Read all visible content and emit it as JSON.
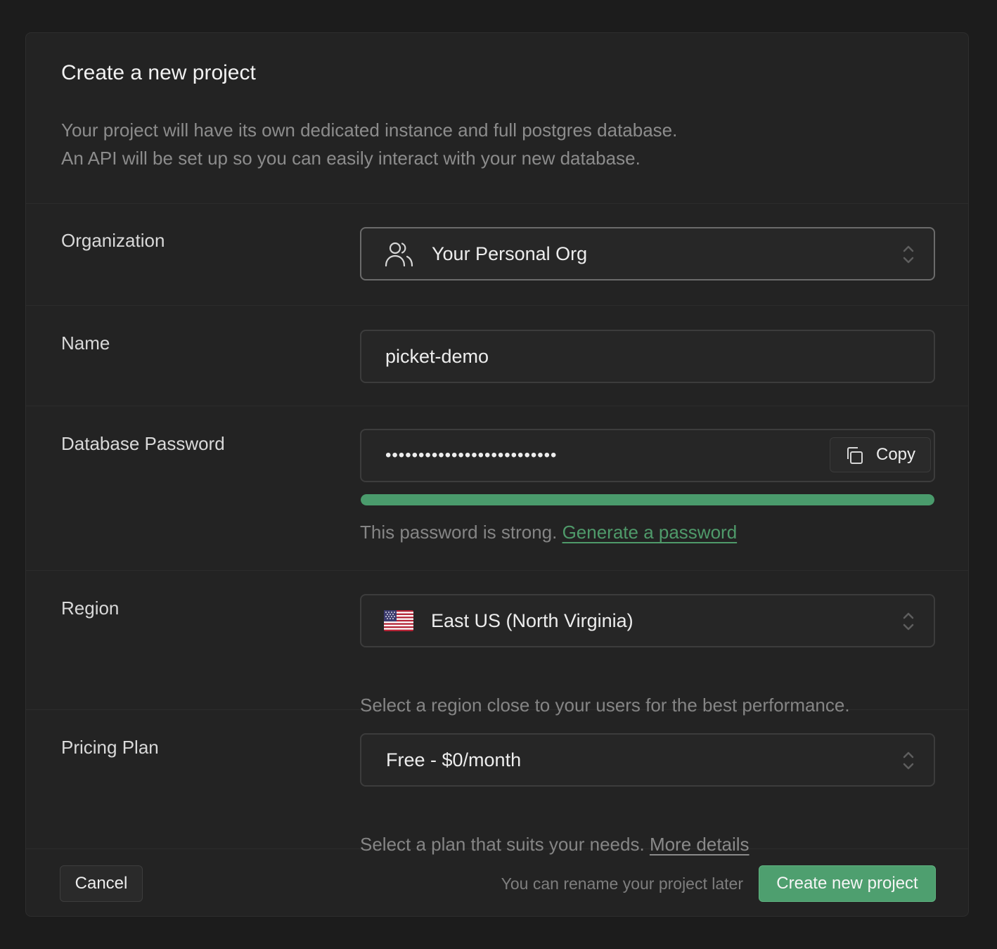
{
  "dialog": {
    "title": "Create a new project",
    "description_line1": "Your project will have its own dedicated instance and full postgres database.",
    "description_line2": "An API will be set up so you can easily interact with your new database."
  },
  "organization": {
    "label": "Organization",
    "value": "Your Personal Org",
    "icon": "users-icon"
  },
  "name": {
    "label": "Name",
    "value": "picket-demo"
  },
  "password": {
    "label": "Database Password",
    "value": "••••••••••••••••••••••••••",
    "copy_label": "Copy",
    "strength_fraction": 1.0,
    "strength_color": "#4a9b6c",
    "help_text": "This password is strong.",
    "generate_link": "Generate a password"
  },
  "region": {
    "label": "Region",
    "value": "East US (North Virginia)",
    "icon": "us-flag-icon",
    "help_text": "Select a region close to your users for the best performance."
  },
  "pricing": {
    "label": "Pricing Plan",
    "value": "Free - $0/month",
    "help_text": "Select a plan that suits your needs.",
    "details_link": "More details"
  },
  "footer": {
    "cancel_label": "Cancel",
    "note": "You can rename your project later",
    "create_label": "Create new project"
  },
  "colors": {
    "background": "#1c1c1c",
    "panel": "#232323",
    "accent": "#4e9f6f"
  }
}
